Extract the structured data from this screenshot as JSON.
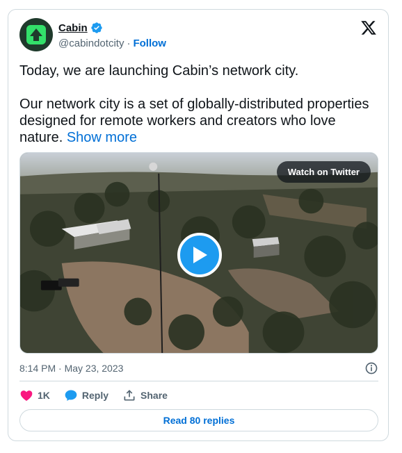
{
  "author": {
    "name": "Cabin",
    "handle": "@cabindotcity",
    "separator": "·",
    "follow_label": "Follow",
    "verified": true
  },
  "tweet": {
    "paragraph1": "Today, we are launching Cabin’s network city.",
    "paragraph2": "Our network city is a set of globally-distributed properties designed for remote workers and creators who love nature.",
    "show_more": "Show more"
  },
  "media": {
    "watch_label": "Watch on Twitter"
  },
  "meta": {
    "timestamp": "8:14 PM · May 23, 2023"
  },
  "actions": {
    "likes": "1K",
    "reply_label": "Reply",
    "share_label": "Share"
  },
  "read_replies_label": "Read 80 replies",
  "colors": {
    "accent": "#1d9bf0",
    "link": "#006fd6",
    "like": "#f91880",
    "avatar_bg": "#1f3a2c",
    "avatar_fg": "#33e06a"
  }
}
